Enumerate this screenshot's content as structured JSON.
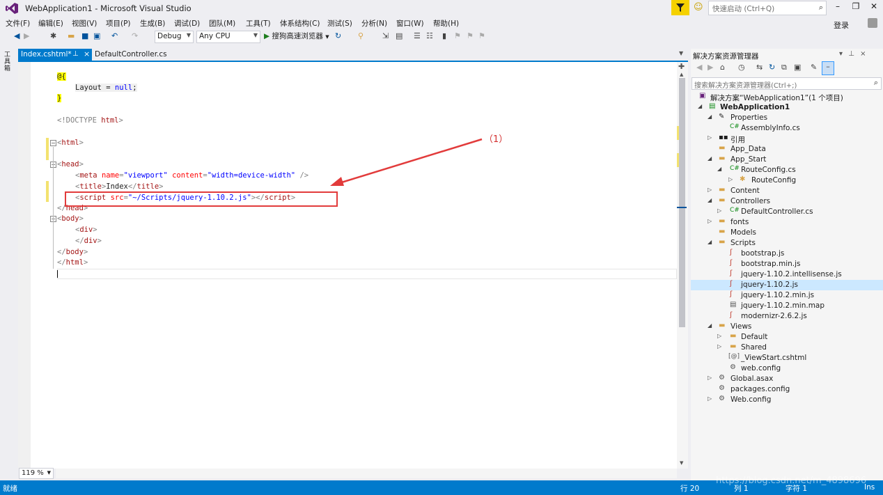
{
  "window": {
    "title": "WebApplication1 - Microsoft Visual Studio",
    "quick_launch_placeholder": "快速启动 (Ctrl+Q)",
    "login": "登录"
  },
  "menu": [
    "文件(F)",
    "编辑(E)",
    "视图(V)",
    "项目(P)",
    "生成(B)",
    "调试(D)",
    "团队(M)",
    "工具(T)",
    "体系结构(C)",
    "测试(S)",
    "分析(N)",
    "窗口(W)",
    "帮助(H)"
  ],
  "toolbar": {
    "config": "Debug",
    "platform": "Any CPU",
    "run_label": "搜狗高速浏览器"
  },
  "left_strip": {
    "toolbox": "工具箱"
  },
  "tabs": [
    {
      "label": "Index.cshtml*",
      "active": true
    },
    {
      "label": "DefaultController.cs",
      "active": false
    }
  ],
  "editor": {
    "lines": {
      "l1": "@{",
      "l2a": "Layout",
      "l2b": " = ",
      "l2c": "null",
      "l2d": ";",
      "l3": "}",
      "l4a": "<!DOCTYPE ",
      "l4b": "html",
      "l4c": ">",
      "l5a": "<",
      "l5b": "html",
      "l5c": ">",
      "l6a": "<",
      "l6b": "head",
      "l6c": ">",
      "l7a": "<",
      "l7b": "meta",
      "l7c": " name",
      "l7d": "=",
      "l7e": "\"viewport\"",
      "l7f": " content",
      "l7g": "=",
      "l7h": "\"width=device-width\"",
      "l7i": " />",
      "l8a": "<",
      "l8b": "title",
      "l8c": ">",
      "l8d": "Index",
      "l8e": "</",
      "l8f": "title",
      "l8g": ">",
      "l9a": "<",
      "l9b": "script",
      "l9c": " src",
      "l9d": "=",
      "l9e": "\"~/Scripts/jquery-1.10.2.js\"",
      "l9f": "></",
      "l9g": "script",
      "l9h": ">",
      "l10a": "</",
      "l10b": "head",
      "l10c": ">",
      "l11a": "<",
      "l11b": "body",
      "l11c": ">",
      "l12a": "<",
      "l12b": "div",
      "l12c": ">",
      "l13a": "</",
      "l13b": "div",
      "l13c": ">",
      "l14a": "</",
      "l14b": "body",
      "l14c": ">",
      "l15a": "</",
      "l15b": "html",
      "l15c": ">"
    },
    "annotation": "（1）",
    "zoom": "119 %"
  },
  "solution_explorer": {
    "title": "解决方案资源管理器",
    "search_placeholder": "搜索解决方案资源管理器(Ctrl+;)",
    "nodes": [
      "解决方案“WebApplication1”(1 个项目)",
      "WebApplication1",
      "Properties",
      "AssemblyInfo.cs",
      "引用",
      "App_Data",
      "App_Start",
      "RouteConfig.cs",
      "RouteConfig",
      "Content",
      "Controllers",
      "DefaultController.cs",
      "fonts",
      "Models",
      "Scripts",
      "bootstrap.js",
      "bootstrap.min.js",
      "jquery-1.10.2.intellisense.js",
      "jquery-1.10.2.js",
      "jquery-1.10.2.min.js",
      "jquery-1.10.2.min.map",
      "modernizr-2.6.2.js",
      "Views",
      "Default",
      "Shared",
      "_ViewStart.cshtml",
      "web.config",
      "Global.asax",
      "packages.config",
      "Web.config"
    ]
  },
  "status": {
    "ready": "就绪",
    "line": "行 20",
    "col": "列 1",
    "char": "字符 1",
    "ins": "Ins"
  },
  "watermark": "https://blog.csdn.net/m_4898696"
}
